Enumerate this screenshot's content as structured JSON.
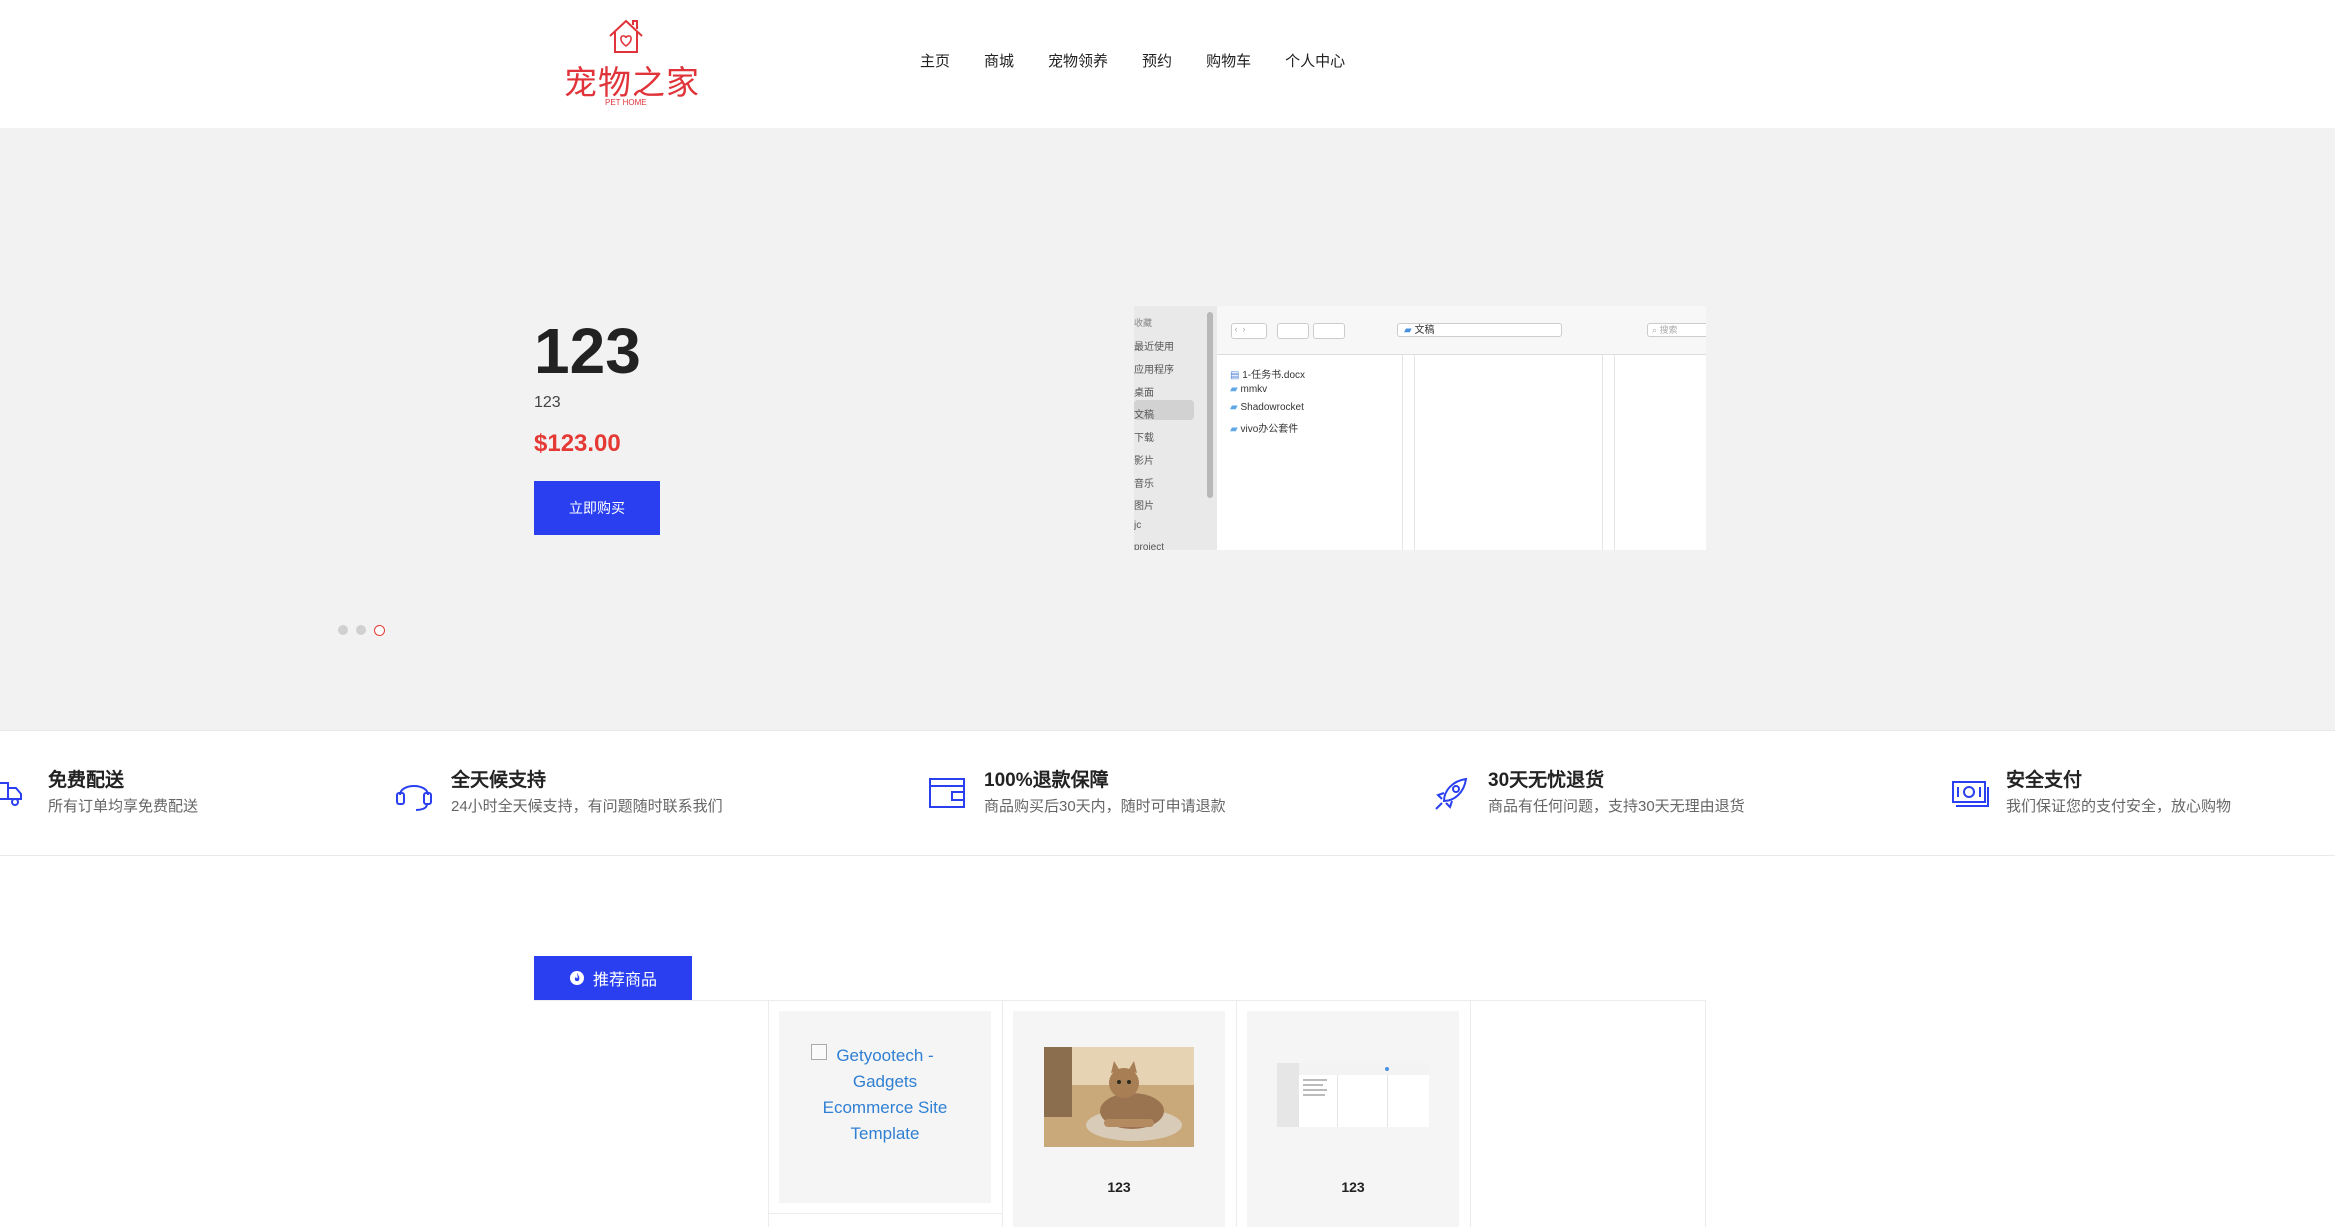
{
  "header": {
    "logo_text": "宠物之家",
    "logo_sub": "PET HOME",
    "nav": [
      "主页",
      "商城",
      "宠物领养",
      "预约",
      "购物车",
      "个人中心"
    ]
  },
  "hero": {
    "title": "123",
    "subtitle": "123",
    "price": "$123.00",
    "button": "立即购买",
    "screenshot": {
      "sidebar": [
        "最近使用",
        "应用程序",
        "桌面",
        "文稿",
        "下载",
        "影片",
        "音乐",
        "图片",
        "jc",
        "project"
      ],
      "folder": "文稿",
      "search_placeholder": "搜索",
      "files": [
        "1-任务书.docx",
        "mmkv",
        "Shadowrocket",
        "vivo办公套件"
      ]
    },
    "slide_count": 3,
    "active_slide": 3
  },
  "features": [
    {
      "title": "免费配送",
      "desc": "所有订单均享免费配送",
      "icon": "truck-icon"
    },
    {
      "title": "全天候支持",
      "desc": "24小时全天候支持，有问题随时联系我们",
      "icon": "headset-icon"
    },
    {
      "title": "100%退款保障",
      "desc": "商品购买后30天内，随时可申请退款",
      "icon": "wallet-icon"
    },
    {
      "title": "30天无忧退货",
      "desc": "商品有任何问题，支持30天无理由退货",
      "icon": "rocket-icon"
    },
    {
      "title": "安全支付",
      "desc": "我们保证您的支付安全，放心购物",
      "icon": "money-icon"
    }
  ],
  "recommended": {
    "tab_label": "推荐商品",
    "products": [
      {
        "alt": "Getyootech - Gadgets Ecommerce Site Template",
        "name": ""
      },
      {
        "name": "123",
        "image": "cat-photo"
      },
      {
        "name": "123",
        "image": "finder-screenshot"
      }
    ]
  },
  "colors": {
    "accent": "#2a40f0",
    "price": "#e53935",
    "brand": "#e0333a"
  }
}
